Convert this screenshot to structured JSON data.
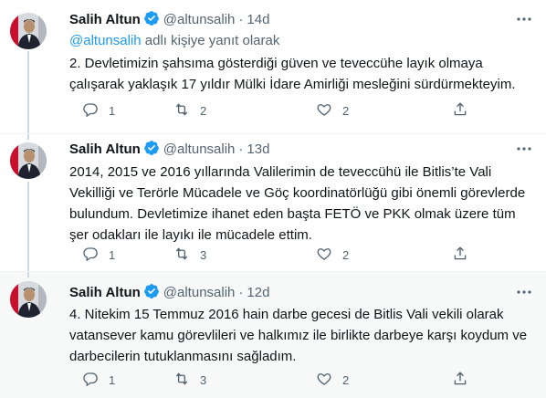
{
  "author": {
    "name": "Salih Altun",
    "handle": "@altunsalih"
  },
  "colors": {
    "link": "#1d9bf0",
    "verified": "#1d9bf0",
    "secondary_text": "#536471"
  },
  "icons": {
    "reply": "reply-icon",
    "retweet": "retweet-icon",
    "like": "heart-icon",
    "share": "share-icon",
    "more": "more-icon",
    "verified": "verified-badge-icon"
  },
  "tweets": [
    {
      "time": "14d",
      "reply_prefix": "",
      "reply_mention": "@altunsalih",
      "reply_suffix": " adlı kişiye yanıt olarak",
      "text": "2. Devletimizin şahsıma gösterdiği güven ve teveccühe layık olmaya çalışarak yaklaşık 17 yıldır Mülki İdare Amirliği mesleğini sürdürmekteyim.",
      "replies": "1",
      "retweets": "2",
      "likes": "2"
    },
    {
      "time": "13d",
      "text": "2014, 2015 ve 2016 yıllarında Valilerimin de teveccühü ile Bitlis’te Vali Vekilliği ve Terörle Mücadele ve Göç koordinatörlüğü gibi önemli görevlerde bulundum. Devletimize ihanet eden başta FETÖ ve PKK olmak üzere tüm şer odakları ile layıkı ile mücadele ettim.",
      "replies": "1",
      "retweets": "3",
      "likes": "2"
    },
    {
      "time": "12d",
      "text": "4. Nitekim 15 Temmuz 2016 hain darbe gecesi de Bitlis Vali vekili olarak vatansever kamu görevlileri ve halkımız ile birlikte darbeye karşı koydum ve darbecilerin tutuklanmasını sağladım.",
      "replies": "1",
      "retweets": "3",
      "likes": "2"
    }
  ]
}
